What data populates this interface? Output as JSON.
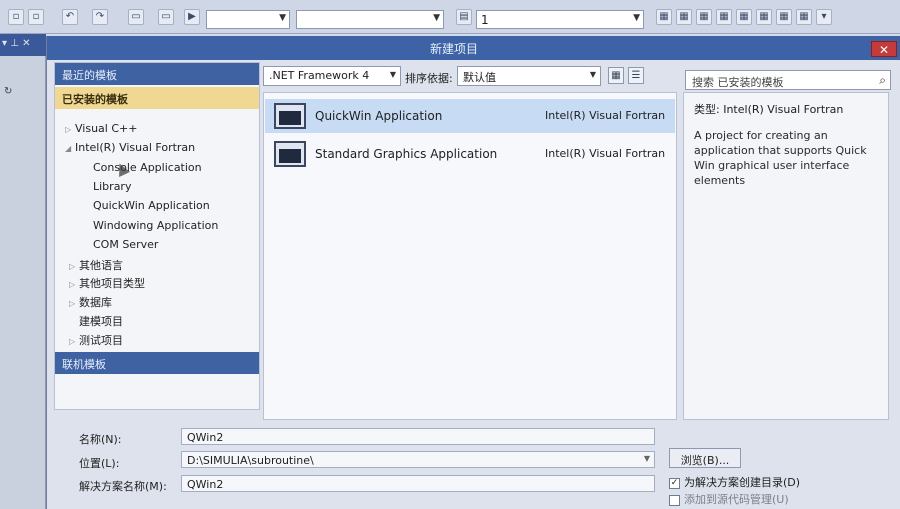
{
  "toolbar": {
    "config_combo": "",
    "platform_combo": "",
    "find_combo": "1"
  },
  "dialog": {
    "title": "新建项目",
    "close_label": "✕"
  },
  "categories": {
    "recent_label": "最近的模板",
    "installed_label": "已安装的模板",
    "online_label": "联机模板",
    "items": [
      {
        "label": "Visual C++",
        "expander": "▷"
      },
      {
        "label": "Intel(R) Visual Fortran",
        "expander": "◢"
      },
      {
        "label": "Console Application",
        "expander": ""
      },
      {
        "label": "Library",
        "expander": ""
      },
      {
        "label": "QuickWin Application",
        "expander": ""
      },
      {
        "label": "Windowing Application",
        "expander": ""
      },
      {
        "label": "COM Server",
        "expander": ""
      },
      {
        "label": "其他语言",
        "expander": "▷"
      },
      {
        "label": "其他项目类型",
        "expander": "▷"
      },
      {
        "label": "数据库",
        "expander": "▷"
      },
      {
        "label": "建模项目",
        "expander": ""
      },
      {
        "label": "测试项目",
        "expander": "▷"
      }
    ]
  },
  "sortbar": {
    "framework": ".NET Framework 4",
    "sort_label": "排序依据:",
    "sort_value": "默认值"
  },
  "templates": [
    {
      "name": "QuickWin Application",
      "language": "Intel(R) Visual Fortran",
      "selected": true
    },
    {
      "name": "Standard Graphics Application",
      "language": "Intel(R) Visual Fortran",
      "selected": false
    }
  ],
  "info": {
    "search_placeholder": "搜索 已安装的模板",
    "search_icon": "search-icon",
    "type_label": "类型:",
    "type_value": "Intel(R) Visual Fortran",
    "description": "A project for creating an application that supports Quick Win graphical user interface elements"
  },
  "form": {
    "name_label": "名称(N):",
    "name_value": "QWin2",
    "location_label": "位置(L):",
    "location_value": "D:\\SIMULIA\\subroutine\\",
    "solution_label": "解决方案名称(M):",
    "solution_value": "QWin2",
    "browse_label": "浏览(B)...",
    "create_dir_label": "为解决方案创建目录(D)",
    "create_dir_checked": true,
    "source_control_label": "添加到源代码管理(U)",
    "source_control_checked": false
  },
  "colors": {
    "titlebar": "#3d63a6",
    "installed_header": "#f0d893",
    "selected_row": "#c7dcf4"
  }
}
